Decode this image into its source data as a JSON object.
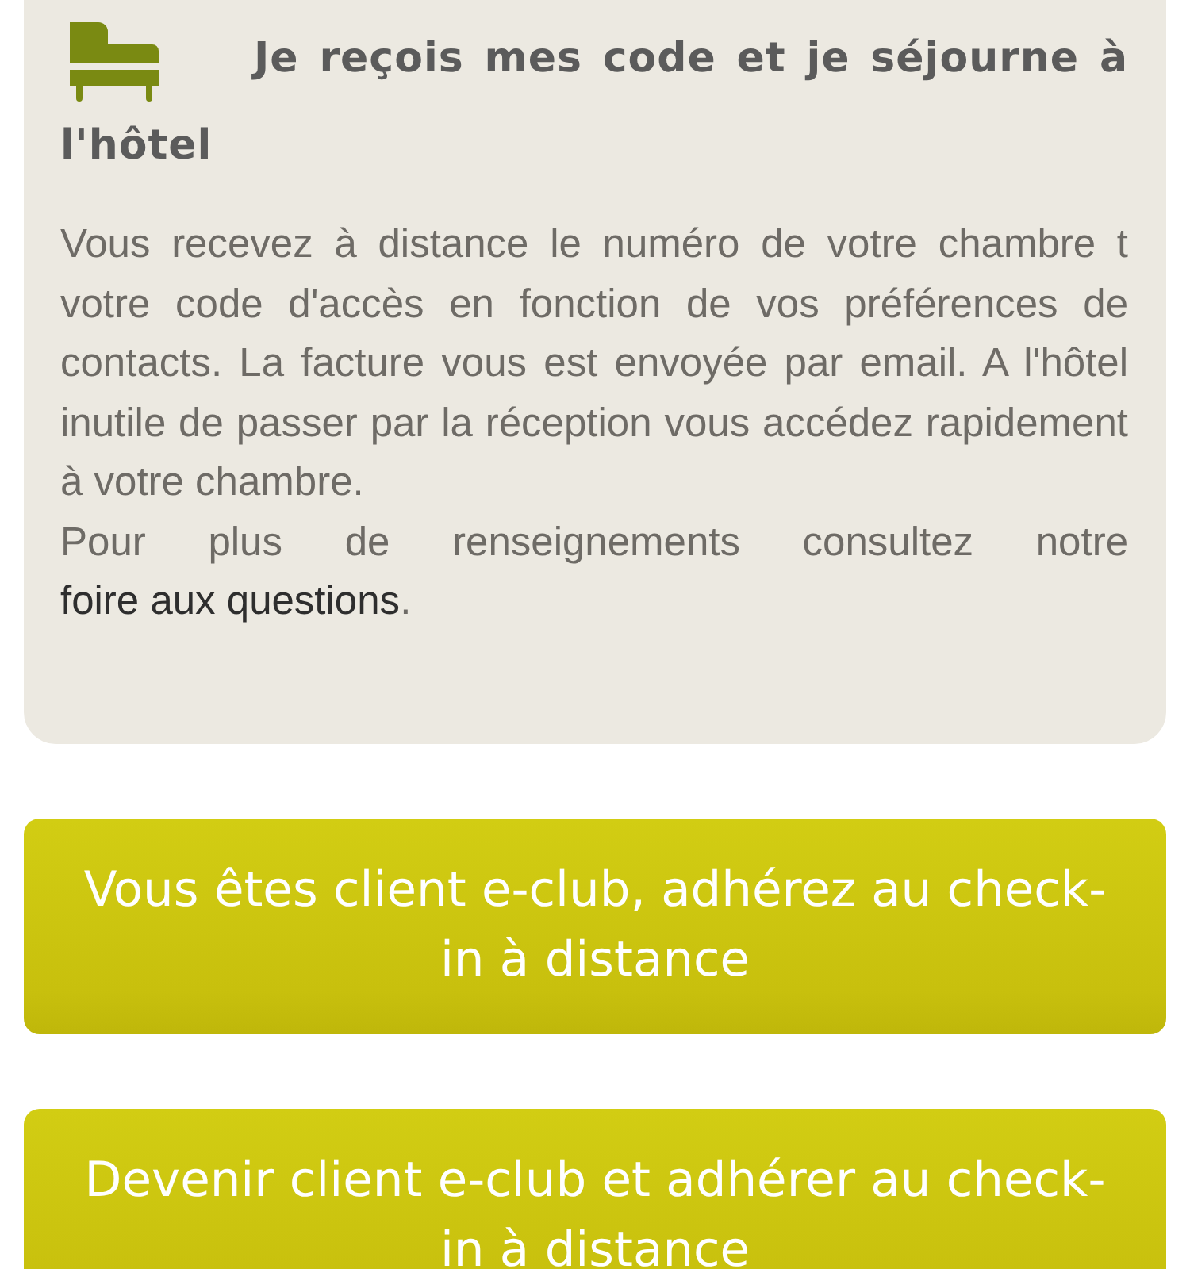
{
  "card": {
    "heading": "Je reçois mes code et je séjourne à l'hôtel",
    "paragraph": "Vous recevez à distance le numéro de votre chambre t votre code d'accès en fonction de vos préférences de contacts. La facture vous est envoyée par email. A l'hôtel inutile de passer par la réception vous accédez rapidement à votre chambre.",
    "faq": {
      "before": "Pour plus de renseignements consultez notre ",
      "link": "foire aux questions",
      "after": "."
    }
  },
  "buttons": [
    {
      "label": "Vous êtes client e-club, adhérez au check-in à distance"
    },
    {
      "label": "Devenir client e-club et adhérer au check-in à distance"
    }
  ]
}
